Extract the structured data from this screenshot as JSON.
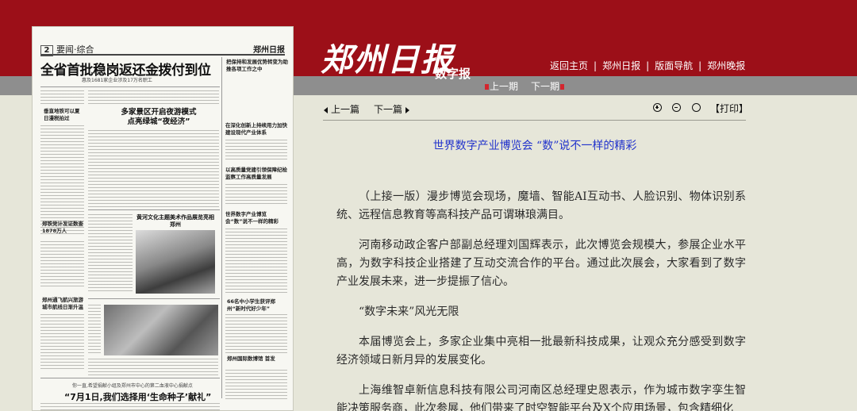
{
  "masthead": {
    "logo": "郑州日报",
    "logo_sub": "数字报",
    "nav": [
      "返回主页",
      "郑州日报",
      "版面导航",
      "郑州晚报"
    ],
    "separator": "|"
  },
  "pager": {
    "prev": "上一期",
    "next": "下一期"
  },
  "article_nav": {
    "prev": "上一篇",
    "next": "下一篇",
    "print": "【打印】"
  },
  "article": {
    "title": "世界数字产业博览会 “数”说不一样的精彩",
    "paragraphs": [
      "（上接一版）漫步博览会现场，魔墙、智能AI互动书、人脸识别、物体识别系统、远程信息教育等高科技产品可谓琳琅满目。",
      "河南移动政企客户部副总经理刘国辉表示，此次博览会规模大，参展企业水平高，为数字科技企业搭建了互动交流合作的平台。通过此次展会，大家看到了数字产业发展未来，进一步提振了信心。",
      "“数字未来”风光无限",
      "本届博览会上，多家企业集中亮相一批最新科技成果，让观众充分感受到数字经济领域日新月异的发展变化。",
      "上海维智卓新信息科技有限公司河南区总经理史恩表示，作为城市数字孪生智能决策服务商，此次参展，他们带来了时空智能平台及X个应用场景，包含精细化"
    ]
  },
  "newspaper_page": {
    "page_num": "2",
    "section": "要闻·综合",
    "brand": "郑州日报",
    "headline": "全省首批稳岗返还金拨付到位",
    "headline_sub": "惠及1681家企业涉及17万名职工",
    "side_headline": "把保持和发展优势转变为助推各项工作之中",
    "mid_headline": "多家景区开启夜游模式\n点亮绿城“夜经济”",
    "left_headline": "垂直地铁可以夏日漫税拍过",
    "right_h1": "在深化创新上持续用力加快建设现代产业体系",
    "right_h2": "以高质量党建引领保障纪检监察工作高质量发展",
    "left_h2": "郑铁党计发证数查1878万人",
    "culture_headline": "黄河文化主题美术作品展览亮相郑州",
    "expo_headline": "世界数字产业博览会“数”说不一样的精彩",
    "left_h3": "郑州通飞航兴旅游城市航线日渐升温",
    "kids_headline": "66名中小学生获评郑州“新时代好少年”",
    "right_h3": "郑州国际数博馆 首发",
    "bottom_sub": "你一直,希望捐献小组及郑州市中心的第二血液中心捐献点",
    "bottom_headline": "“7月1日,我们选择用‘生命种子’献礼”"
  }
}
